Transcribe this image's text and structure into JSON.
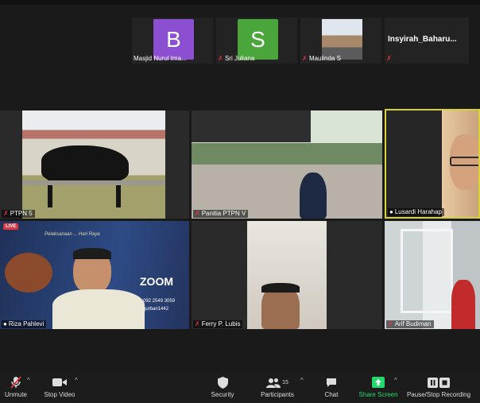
{
  "gallery_top": [
    {
      "name": "Masjid Nurul Ima...",
      "initial": "B",
      "color": "#8d4fd1"
    },
    {
      "name": "Sri Juliana",
      "initial": "S",
      "color": "#4aa63a"
    },
    {
      "name": "Maulinda S"
    },
    {
      "name": "Insyirah_Baharu..."
    }
  ],
  "tiles": [
    {
      "name": "PTPN 5"
    },
    {
      "name": "Panitia PTPN V"
    },
    {
      "name": "Lusardi Harahap"
    },
    {
      "name": "Riza Pahlevi"
    },
    {
      "name": "Ferry P. Lubis"
    },
    {
      "name": "Arif Budiman"
    }
  ],
  "slide": {
    "live": "LIVE",
    "heading": "Pelaksanaan ... Hari Raya",
    "zoom": "ZOOM",
    "meeting_id": "092 2549 3059",
    "password": "qurban1442"
  },
  "toolbar": {
    "unmute": "Unmute",
    "stop_video": "Stop Video",
    "security": "Security",
    "participants": "Participants",
    "participants_count": "15",
    "chat": "Chat",
    "share_screen": "Share Screen",
    "record": "Pause/Stop Recording"
  },
  "colors": {
    "accent_green": "#23d96b",
    "muted_red": "#e0353f"
  }
}
